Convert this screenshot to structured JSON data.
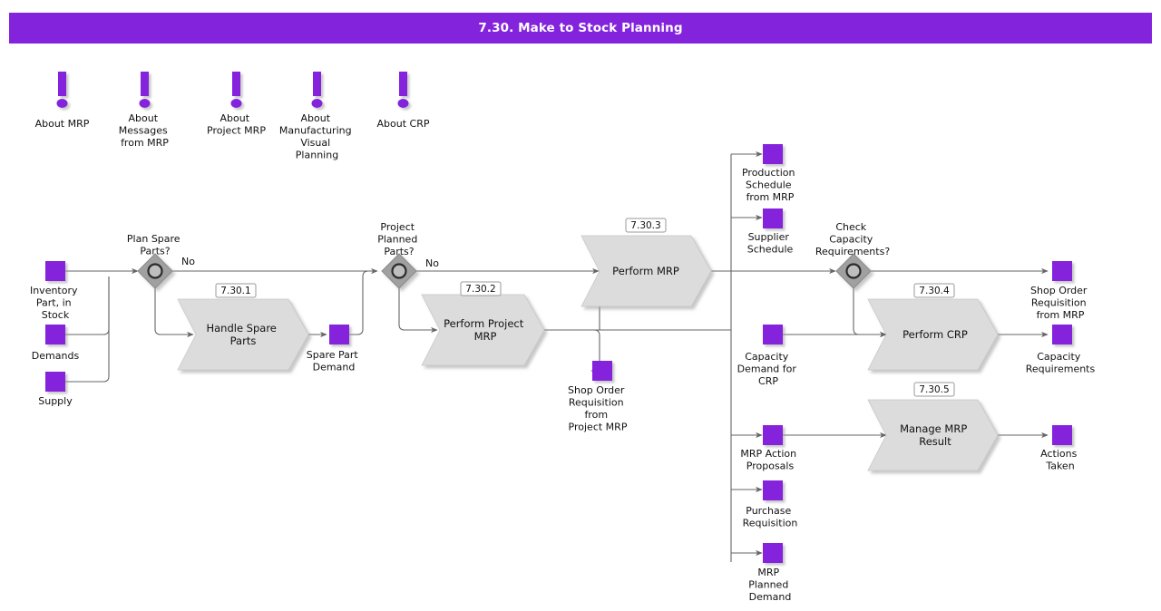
{
  "header": {
    "title": "7.30. Make to Stock Planning",
    "bar_color": "#8423DC",
    "title_color": "#FFFFFF"
  },
  "colors": {
    "accent_purple": "#8423DC",
    "process_fill": "#DCDCDC",
    "connector": "#666666",
    "decision_fill": "#A0A0A0"
  },
  "info_links": [
    {
      "id": "about-mrp",
      "label": "About MRP",
      "icon": "exclamation-icon"
    },
    {
      "id": "about-messages-from-mrp",
      "label": "About\nMessages\nfrom MRP",
      "icon": "exclamation-icon"
    },
    {
      "id": "about-project-mrp",
      "label": "About\nProject MRP",
      "icon": "exclamation-icon"
    },
    {
      "id": "about-manufacturing-visual-planning",
      "label": "About\nManufacturing\nVisual\nPlanning",
      "icon": "exclamation-icon"
    },
    {
      "id": "about-crp",
      "label": "About CRP",
      "icon": "exclamation-icon"
    }
  ],
  "inputs": [
    {
      "id": "inventory-part-in-stock",
      "label": "Inventory\nPart, in\nStock"
    },
    {
      "id": "demands",
      "label": "Demands"
    },
    {
      "id": "supply",
      "label": "Supply"
    }
  ],
  "decisions": [
    {
      "id": "plan-spare-parts",
      "label": "Plan Spare\nParts?",
      "branch_label": "No"
    },
    {
      "id": "project-planned-parts",
      "label": "Project\nPlanned\nParts?",
      "branch_label": "No"
    },
    {
      "id": "check-capacity-requirements",
      "label": "Check\nCapacity\nRequirements?",
      "branch_label": ""
    }
  ],
  "processes": [
    {
      "id": "handle-spare-parts",
      "number": "7.30.1",
      "label": "Handle Spare\nParts"
    },
    {
      "id": "perform-project-mrp",
      "number": "7.30.2",
      "label": "Perform Project\nMRP"
    },
    {
      "id": "perform-mrp",
      "number": "7.30.3",
      "label": "Perform MRP"
    },
    {
      "id": "perform-crp",
      "number": "7.30.4",
      "label": "Perform CRP"
    },
    {
      "id": "manage-mrp-result",
      "number": "7.30.5",
      "label": "Manage MRP\nResult"
    }
  ],
  "artifacts": [
    {
      "id": "spare-part-demand",
      "label": "Spare Part\nDemand"
    },
    {
      "id": "shop-order-requisition-from-project-mrp",
      "label": "Shop Order\nRequisition\nfrom\nProject MRP"
    },
    {
      "id": "production-schedule-from-mrp",
      "label": "Production\nSchedule\nfrom MRP"
    },
    {
      "id": "supplier-schedule",
      "label": "Supplier\nSchedule"
    },
    {
      "id": "capacity-demand-for-crp",
      "label": "Capacity\nDemand for\nCRP"
    },
    {
      "id": "mrp-action-proposals",
      "label": "MRP Action\nProposals"
    },
    {
      "id": "purchase-requisition",
      "label": "Purchase\nRequisition"
    },
    {
      "id": "mrp-planned-demand",
      "label": "MRP\nPlanned\nDemand"
    },
    {
      "id": "shop-order-requisition-from-mrp",
      "label": "Shop Order\nRequisition\nfrom MRP"
    },
    {
      "id": "capacity-requirements",
      "label": "Capacity\nRequirements"
    },
    {
      "id": "actions-taken",
      "label": "Actions\nTaken"
    }
  ]
}
